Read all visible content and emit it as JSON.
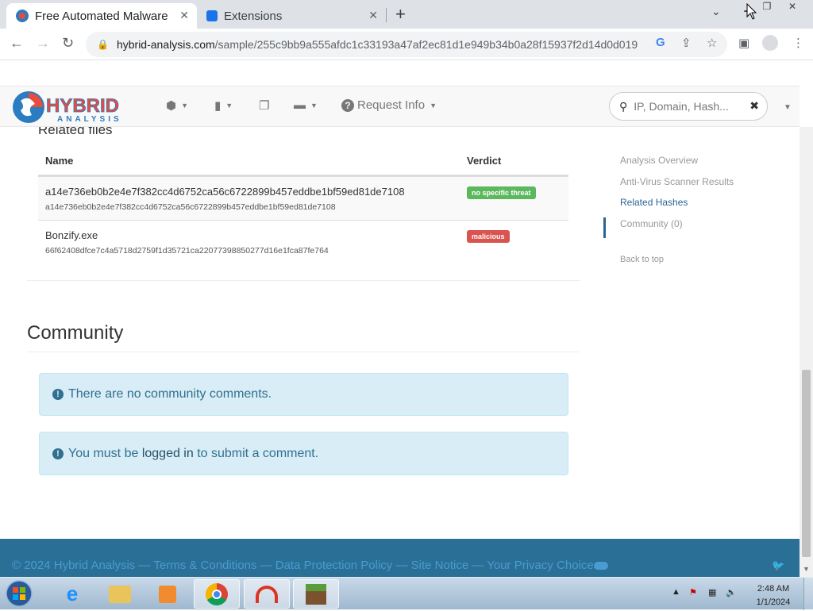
{
  "browser": {
    "tabs": [
      {
        "title": "Free Automated Malware Analysis Service"
      },
      {
        "title": "Extensions"
      }
    ],
    "url_host": "hybrid-analysis.com",
    "url_path": "/sample/255c9bb9a555afdc1c33193a47af2ec81d1e949b34b0a28f15937f2d14d0d019"
  },
  "site": {
    "logo_top": "HYBRID",
    "logo_bottom": "ANALYSIS",
    "request_info": "Request Info",
    "search_placeholder": "IP, Domain, Hash..."
  },
  "related_files": {
    "title": "Related files",
    "col_name": "Name",
    "col_verdict": "Verdict",
    "rows": [
      {
        "name": "a14e736eb0b2e4e7f382cc4d6752ca56c6722899b457eddbe1bf59ed81de7108",
        "hash": "a14e736eb0b2e4e7f382cc4d6752ca56c6722899b457eddbe1bf59ed81de7108",
        "verdict": "no specific threat"
      },
      {
        "name": "Bonzify.exe",
        "hash": "66f62408dfce7c4a5718d2759f1d35721ca22077398850277d16e1fca87fe764",
        "verdict": "malicious"
      }
    ]
  },
  "community": {
    "title": "Community",
    "no_comments": "There are no community comments.",
    "login_prefix": "You must be ",
    "login_link": "logged in",
    "login_suffix": " to submit a comment."
  },
  "sidenav": {
    "items": [
      "Analysis Overview",
      "Anti-Virus Scanner Results",
      "Related Hashes",
      "Community (0)"
    ],
    "back_to_top": "Back to top"
  },
  "footer": {
    "text": "© 2024 Hybrid Analysis — Terms & Conditions — Data Protection Policy — Site Notice — Your Privacy Choices"
  },
  "taskbar": {
    "time": "2:48 AM",
    "date": "1/1/2024"
  },
  "colors": {
    "green_badge": "#5cb85c",
    "red_badge": "#d9534f",
    "info_alert": "#d9edf7",
    "footer": "#2a6f96"
  }
}
